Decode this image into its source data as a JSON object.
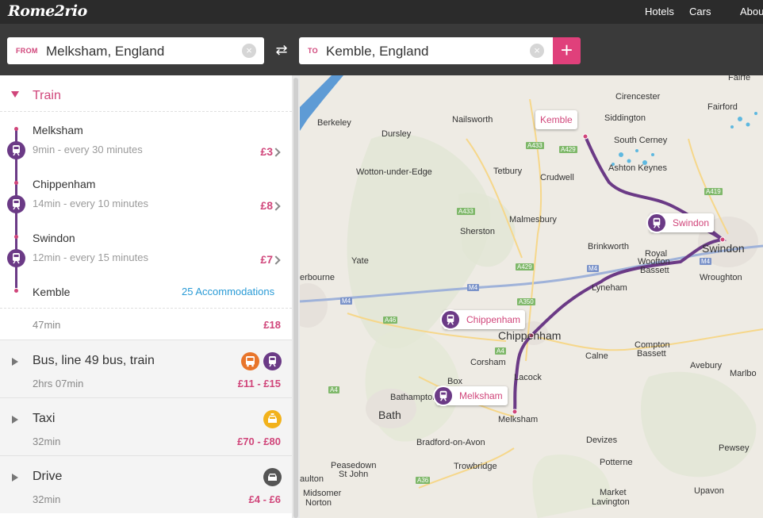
{
  "app": {
    "logo_text": "Rome2rio"
  },
  "nav": {
    "hotels": "Hotels",
    "cars": "Cars",
    "about": "Abou"
  },
  "search": {
    "from_tag": "FROM",
    "from_value": "Melksham, England",
    "to_tag": "TO",
    "to_value": "Kemble, England",
    "clear_glyph": "×",
    "swap_glyph": "⇄",
    "add_glyph": "+"
  },
  "train_route": {
    "title": "Train",
    "stops": [
      {
        "name": "Melksham",
        "info": "9min - every 30 minutes",
        "price": "£3"
      },
      {
        "name": "Chippenham",
        "info": "14min - every 10 minutes",
        "price": "£8"
      },
      {
        "name": "Swindon",
        "info": "12min - every 15 minutes",
        "price": "£7"
      },
      {
        "name": "Kemble"
      }
    ],
    "accommodations": "25 Accommodations",
    "total_time": "47min",
    "total_price": "£18"
  },
  "options": [
    {
      "title": "Bus, line 49 bus, train",
      "duration": "2hrs 07min",
      "price": "£11 - £15",
      "icons": [
        "bus-icon",
        "train-icon"
      ]
    },
    {
      "title": "Taxi",
      "duration": "32min",
      "price": "£70 - £80",
      "icons": [
        "taxi-icon"
      ]
    },
    {
      "title": "Drive",
      "duration": "32min",
      "price": "£4 - £6",
      "icons": [
        "car-icon"
      ]
    }
  ],
  "colors": {
    "accent": "#d0457a",
    "train": "#6b3a86",
    "bus": "#e8752b",
    "taxi": "#f2b21b",
    "car": "#555555",
    "link": "#2a9bd6"
  },
  "map": {
    "places": [
      "Cirencester",
      "Fairford",
      "Siddington",
      "Berkeley",
      "Nailsworth",
      "Dursley",
      "South Cerney",
      "Ashton Keynes",
      "Wotton-under-Edge",
      "Tetbury",
      "Crudwell",
      "Malmesbury",
      "Sherston",
      "Brinkworth",
      "Royal",
      "Wootton",
      "Bassett",
      "Swindon",
      "Wroughton",
      "Yate",
      "erbourne",
      "Lyneham",
      "Chippenham",
      "Compton",
      "Bassett",
      "Calne",
      "Avebury",
      "Corsham",
      "Lacock",
      "Box",
      "Marlbo",
      "Bathampton",
      "Bath",
      "Melksham",
      "Bradford-on-Avon",
      "Devizes",
      "Pewsey",
      "Trowbridge",
      "Potterne",
      "Peasedown",
      "St John",
      "aulton",
      "Midsomer",
      "Norton",
      "Market",
      "Lavington",
      "Upavon",
      "Fairfe"
    ],
    "roads": [
      "A433",
      "A429",
      "A419",
      "A433",
      "A429",
      "M4",
      "M4",
      "M4",
      "M4",
      "A350",
      "A46",
      "A4",
      "A4",
      "A36"
    ],
    "station_callouts": [
      "Kemble",
      "Swindon",
      "Chippenham",
      "Melksham"
    ]
  }
}
